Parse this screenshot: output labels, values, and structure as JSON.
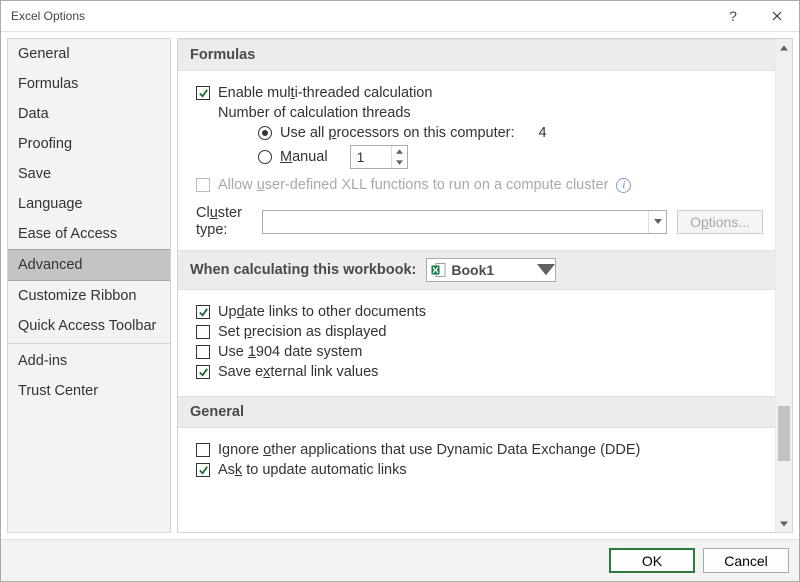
{
  "title": "Excel Options",
  "sidebar": {
    "items": [
      "General",
      "Formulas",
      "Data",
      "Proofing",
      "Save",
      "Language",
      "Ease of Access",
      "Advanced",
      "Customize Ribbon",
      "Quick Access Toolbar"
    ],
    "items2": [
      "Add-ins",
      "Trust Center"
    ],
    "selected": "Advanced"
  },
  "formulas": {
    "header": "Formulas",
    "enable_mt_pre": "Enable mul",
    "enable_mt_u": "t",
    "enable_mt_post": "i-threaded calculation",
    "numthreads_label": "Number of calculation threads",
    "useall_pre": "Use all ",
    "useall_u": "p",
    "useall_post": "rocessors on this computer:",
    "processor_count": "4",
    "manual_u": "M",
    "manual_post": "anual",
    "manual_value": "1",
    "allow_pre": "Allow ",
    "allow_u": "u",
    "allow_post": "ser-defined XLL functions to run on a compute cluster",
    "cluster_lbl1": "Cl",
    "cluster_u": "u",
    "cluster_lbl2": "ster type:",
    "options_pre": "O",
    "options_u": "p",
    "options_post": "tions..."
  },
  "calc": {
    "header": "When calculating this workbook:",
    "workbook": "Book1",
    "update_pre": "Up",
    "update_u": "d",
    "update_post": "ate links to other documents",
    "precision_pre": "Set ",
    "precision_u": "p",
    "precision_post": "recision as displayed",
    "date1904_pre": "Use ",
    "date1904_u": "1",
    "date1904_post": "904 date system",
    "saveext_pre": "Save e",
    "saveext_u": "x",
    "saveext_post": "ternal link values"
  },
  "general": {
    "header": "General",
    "ignore_pre": "Ignore ",
    "ignore_u": "o",
    "ignore_post": "ther applications that use Dynamic Data Exchange (DDE)",
    "ask_pre": "As",
    "ask_u": "k",
    "ask_post": " to update automatic links"
  },
  "footer": {
    "ok": "OK",
    "cancel": "Cancel"
  }
}
